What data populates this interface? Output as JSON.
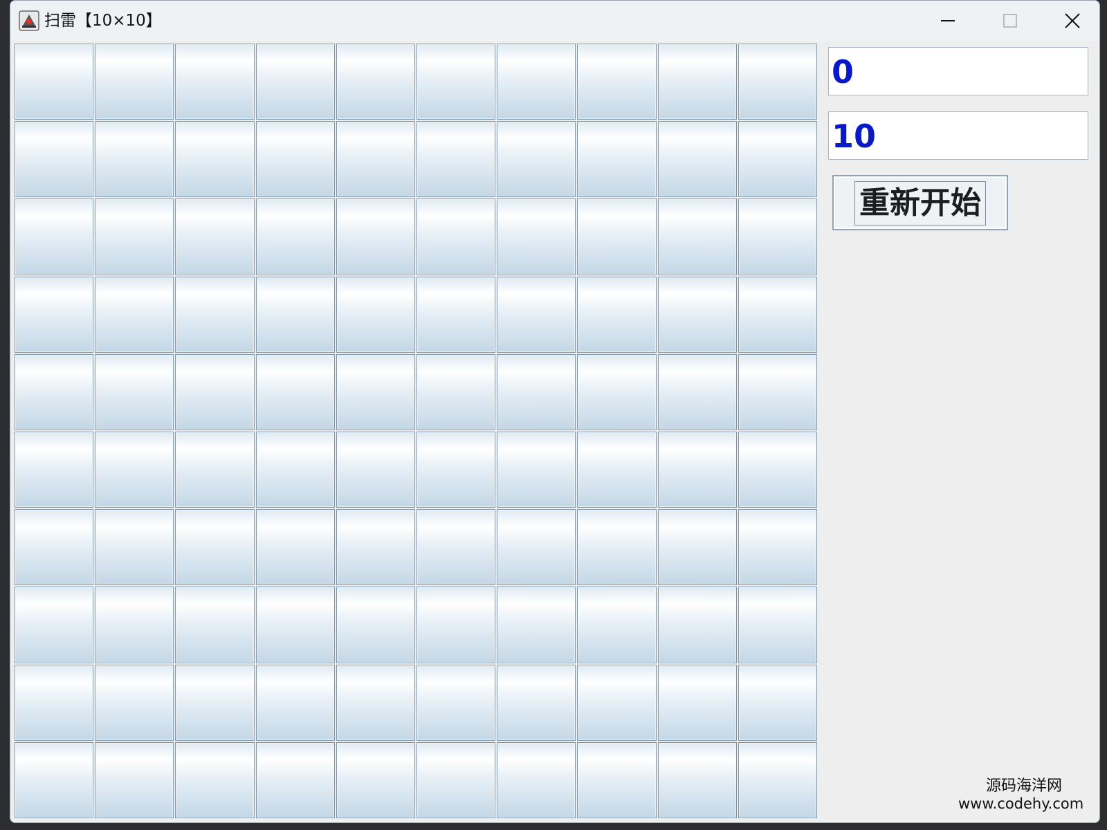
{
  "window": {
    "title": "扫雷【10×10】",
    "minimize_icon": "minimize-icon",
    "maximize_icon": "maximize-icon",
    "close_icon": "close-icon"
  },
  "board": {
    "rows": 10,
    "cols": 10,
    "cell_state": "covered"
  },
  "side_panel": {
    "counter_field_value": "0",
    "mines_field_value": "10",
    "restart_button_label": "重新开始"
  },
  "watermark": {
    "line1": "源码海洋网",
    "line2": "www.codehy.com"
  },
  "colors": {
    "field_text": "#0a19c8",
    "cell_border": "#7d95a8"
  }
}
